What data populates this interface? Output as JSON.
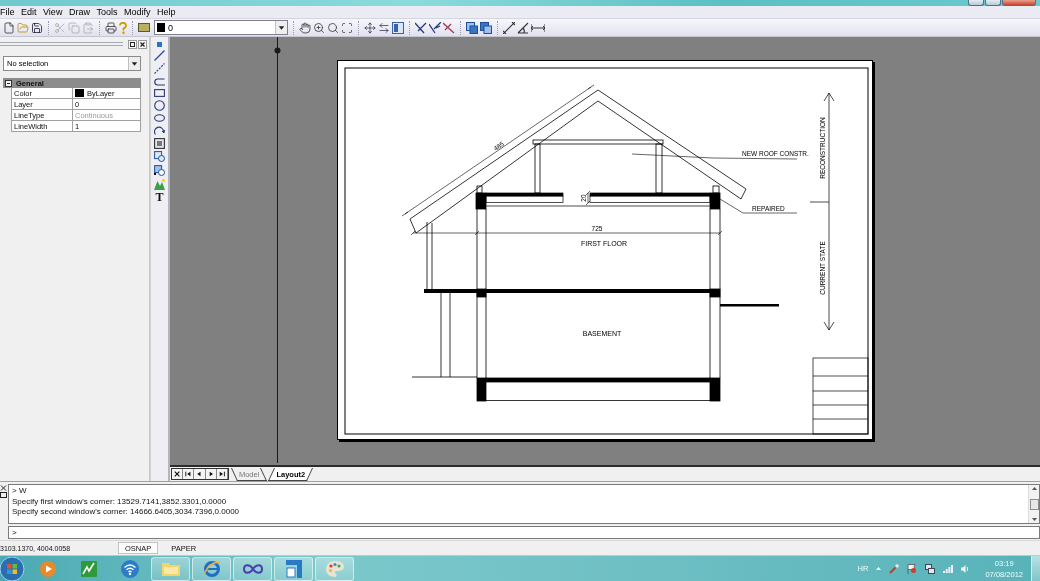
{
  "menu": [
    {
      "label": "File"
    },
    {
      "label": "Edit"
    },
    {
      "label": "View"
    },
    {
      "label": "Draw"
    },
    {
      "label": "Tools"
    },
    {
      "label": "Modify"
    },
    {
      "label": "Help"
    }
  ],
  "toolbar": {
    "layer_field": {
      "value": "0"
    }
  },
  "properties": {
    "selection": {
      "value": "No selection"
    },
    "groups": [
      {
        "title": "General",
        "expanded": true,
        "rows": [
          {
            "name": "Color",
            "value": "ByLayer",
            "kind": "swatch",
            "disabled": false
          },
          {
            "name": "Layer",
            "value": "0",
            "kind": "text",
            "disabled": false
          },
          {
            "name": "LineType",
            "value": "Continuous",
            "kind": "text",
            "disabled": true
          },
          {
            "name": "LineWidth",
            "value": "1",
            "kind": "text",
            "disabled": false
          }
        ]
      }
    ]
  },
  "draw_toolbar": {
    "text_tool": "T"
  },
  "drawing": {
    "rafter_dimension": "485",
    "roof_note": "NEW ROOF CONSTR.",
    "gap_dimension": "20",
    "repair_note": "REPAIRED",
    "span_dimension": "725",
    "upper_room": "FIRST FLOOR",
    "lower_room": "BASEMENT",
    "upper_stage": "RECONSTRUCTION",
    "lower_stage": "CURRENT STATE"
  },
  "layout_tabs": [
    {
      "label": "Model",
      "selected": false
    },
    {
      "label": "Layout2",
      "selected": true
    }
  ],
  "command_line": {
    "history": [
      "> W",
      "Specify first window's corner: 13529.7141,3852.3301,0.0000",
      "Specify second window's corner: 14666.6405,3034.7396,0.0000"
    ],
    "prompt": ">"
  },
  "status_bar": {
    "coordinates": "3103.1370, 4004.0058",
    "toggles": [
      {
        "label": "OSNAP",
        "on": true
      },
      {
        "label": "PAPER",
        "on": false
      }
    ]
  },
  "taskbar": {
    "apps": [
      {
        "kind": "media",
        "running": false
      },
      {
        "kind": "monitor",
        "running": false
      },
      {
        "kind": "wifi",
        "running": false
      },
      {
        "kind": "folder",
        "running": true
      },
      {
        "kind": "browser",
        "running": true
      },
      {
        "kind": "loop",
        "running": true
      },
      {
        "kind": "blocks",
        "running": true
      },
      {
        "kind": "paint",
        "running": true
      }
    ],
    "language": "HR",
    "time": "03:19",
    "date": "07/08/2012"
  }
}
